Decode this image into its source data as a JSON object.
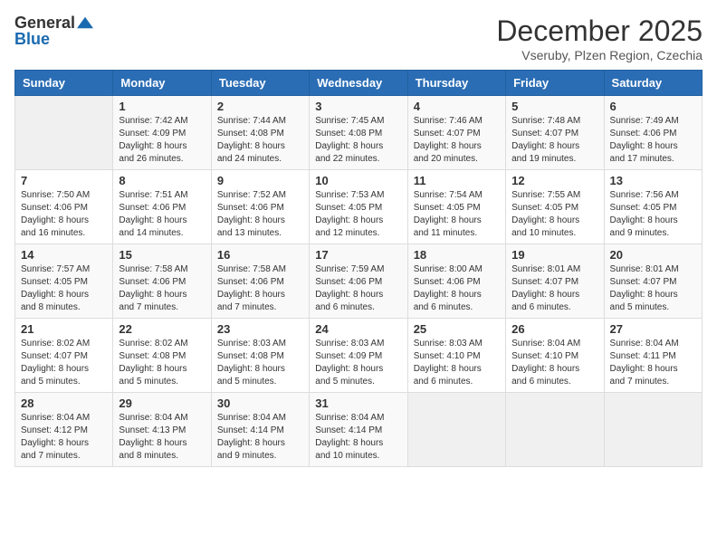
{
  "header": {
    "logo_general": "General",
    "logo_blue": "Blue",
    "title": "December 2025",
    "location": "Vseruby, Plzen Region, Czechia"
  },
  "days_of_week": [
    "Sunday",
    "Monday",
    "Tuesday",
    "Wednesday",
    "Thursday",
    "Friday",
    "Saturday"
  ],
  "weeks": [
    [
      {
        "day": "",
        "info": ""
      },
      {
        "day": "1",
        "info": "Sunrise: 7:42 AM\nSunset: 4:09 PM\nDaylight: 8 hours\nand 26 minutes."
      },
      {
        "day": "2",
        "info": "Sunrise: 7:44 AM\nSunset: 4:08 PM\nDaylight: 8 hours\nand 24 minutes."
      },
      {
        "day": "3",
        "info": "Sunrise: 7:45 AM\nSunset: 4:08 PM\nDaylight: 8 hours\nand 22 minutes."
      },
      {
        "day": "4",
        "info": "Sunrise: 7:46 AM\nSunset: 4:07 PM\nDaylight: 8 hours\nand 20 minutes."
      },
      {
        "day": "5",
        "info": "Sunrise: 7:48 AM\nSunset: 4:07 PM\nDaylight: 8 hours\nand 19 minutes."
      },
      {
        "day": "6",
        "info": "Sunrise: 7:49 AM\nSunset: 4:06 PM\nDaylight: 8 hours\nand 17 minutes."
      }
    ],
    [
      {
        "day": "7",
        "info": "Sunrise: 7:50 AM\nSunset: 4:06 PM\nDaylight: 8 hours\nand 16 minutes."
      },
      {
        "day": "8",
        "info": "Sunrise: 7:51 AM\nSunset: 4:06 PM\nDaylight: 8 hours\nand 14 minutes."
      },
      {
        "day": "9",
        "info": "Sunrise: 7:52 AM\nSunset: 4:06 PM\nDaylight: 8 hours\nand 13 minutes."
      },
      {
        "day": "10",
        "info": "Sunrise: 7:53 AM\nSunset: 4:05 PM\nDaylight: 8 hours\nand 12 minutes."
      },
      {
        "day": "11",
        "info": "Sunrise: 7:54 AM\nSunset: 4:05 PM\nDaylight: 8 hours\nand 11 minutes."
      },
      {
        "day": "12",
        "info": "Sunrise: 7:55 AM\nSunset: 4:05 PM\nDaylight: 8 hours\nand 10 minutes."
      },
      {
        "day": "13",
        "info": "Sunrise: 7:56 AM\nSunset: 4:05 PM\nDaylight: 8 hours\nand 9 minutes."
      }
    ],
    [
      {
        "day": "14",
        "info": "Sunrise: 7:57 AM\nSunset: 4:05 PM\nDaylight: 8 hours\nand 8 minutes."
      },
      {
        "day": "15",
        "info": "Sunrise: 7:58 AM\nSunset: 4:06 PM\nDaylight: 8 hours\nand 7 minutes."
      },
      {
        "day": "16",
        "info": "Sunrise: 7:58 AM\nSunset: 4:06 PM\nDaylight: 8 hours\nand 7 minutes."
      },
      {
        "day": "17",
        "info": "Sunrise: 7:59 AM\nSunset: 4:06 PM\nDaylight: 8 hours\nand 6 minutes."
      },
      {
        "day": "18",
        "info": "Sunrise: 8:00 AM\nSunset: 4:06 PM\nDaylight: 8 hours\nand 6 minutes."
      },
      {
        "day": "19",
        "info": "Sunrise: 8:01 AM\nSunset: 4:07 PM\nDaylight: 8 hours\nand 6 minutes."
      },
      {
        "day": "20",
        "info": "Sunrise: 8:01 AM\nSunset: 4:07 PM\nDaylight: 8 hours\nand 5 minutes."
      }
    ],
    [
      {
        "day": "21",
        "info": "Sunrise: 8:02 AM\nSunset: 4:07 PM\nDaylight: 8 hours\nand 5 minutes."
      },
      {
        "day": "22",
        "info": "Sunrise: 8:02 AM\nSunset: 4:08 PM\nDaylight: 8 hours\nand 5 minutes."
      },
      {
        "day": "23",
        "info": "Sunrise: 8:03 AM\nSunset: 4:08 PM\nDaylight: 8 hours\nand 5 minutes."
      },
      {
        "day": "24",
        "info": "Sunrise: 8:03 AM\nSunset: 4:09 PM\nDaylight: 8 hours\nand 5 minutes."
      },
      {
        "day": "25",
        "info": "Sunrise: 8:03 AM\nSunset: 4:10 PM\nDaylight: 8 hours\nand 6 minutes."
      },
      {
        "day": "26",
        "info": "Sunrise: 8:04 AM\nSunset: 4:10 PM\nDaylight: 8 hours\nand 6 minutes."
      },
      {
        "day": "27",
        "info": "Sunrise: 8:04 AM\nSunset: 4:11 PM\nDaylight: 8 hours\nand 7 minutes."
      }
    ],
    [
      {
        "day": "28",
        "info": "Sunrise: 8:04 AM\nSunset: 4:12 PM\nDaylight: 8 hours\nand 7 minutes."
      },
      {
        "day": "29",
        "info": "Sunrise: 8:04 AM\nSunset: 4:13 PM\nDaylight: 8 hours\nand 8 minutes."
      },
      {
        "day": "30",
        "info": "Sunrise: 8:04 AM\nSunset: 4:14 PM\nDaylight: 8 hours\nand 9 minutes."
      },
      {
        "day": "31",
        "info": "Sunrise: 8:04 AM\nSunset: 4:14 PM\nDaylight: 8 hours\nand 10 minutes."
      },
      {
        "day": "",
        "info": ""
      },
      {
        "day": "",
        "info": ""
      },
      {
        "day": "",
        "info": ""
      }
    ]
  ]
}
